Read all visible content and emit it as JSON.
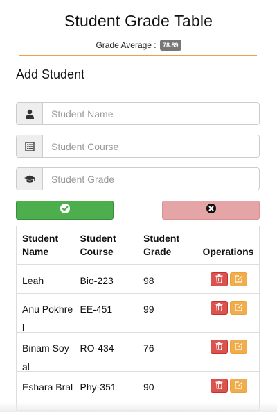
{
  "header": {
    "title": "Student Grade Table",
    "average_label": "Grade Average :",
    "average_value": "78.89"
  },
  "form": {
    "title": "Add Student",
    "name_placeholder": "Student Name",
    "course_placeholder": "Student Course",
    "grade_placeholder": "Student Grade",
    "add_icon": "check-circle-icon",
    "cancel_icon": "times-circle-icon"
  },
  "table": {
    "headers": {
      "name": "Student Name",
      "course": "Student Course",
      "grade": "Student Grade",
      "operations": "Operations"
    },
    "rows": [
      {
        "name": "Leah",
        "course": "Bio-223",
        "grade": "98"
      },
      {
        "name": "Anu Pokhrel",
        "course": "EE-451",
        "grade": "99"
      },
      {
        "name": "Binam Soyal",
        "course": "RO-434",
        "grade": "76"
      },
      {
        "name": "Eshara Bral",
        "course": "Phy-351",
        "grade": "90"
      }
    ]
  },
  "colors": {
    "accent_line": "#f0a040",
    "add_button": "#4cae4c",
    "cancel_button": "#e5a4a6",
    "delete_button": "#d9534f",
    "edit_button": "#f0ad4e",
    "badge": "#777777"
  }
}
